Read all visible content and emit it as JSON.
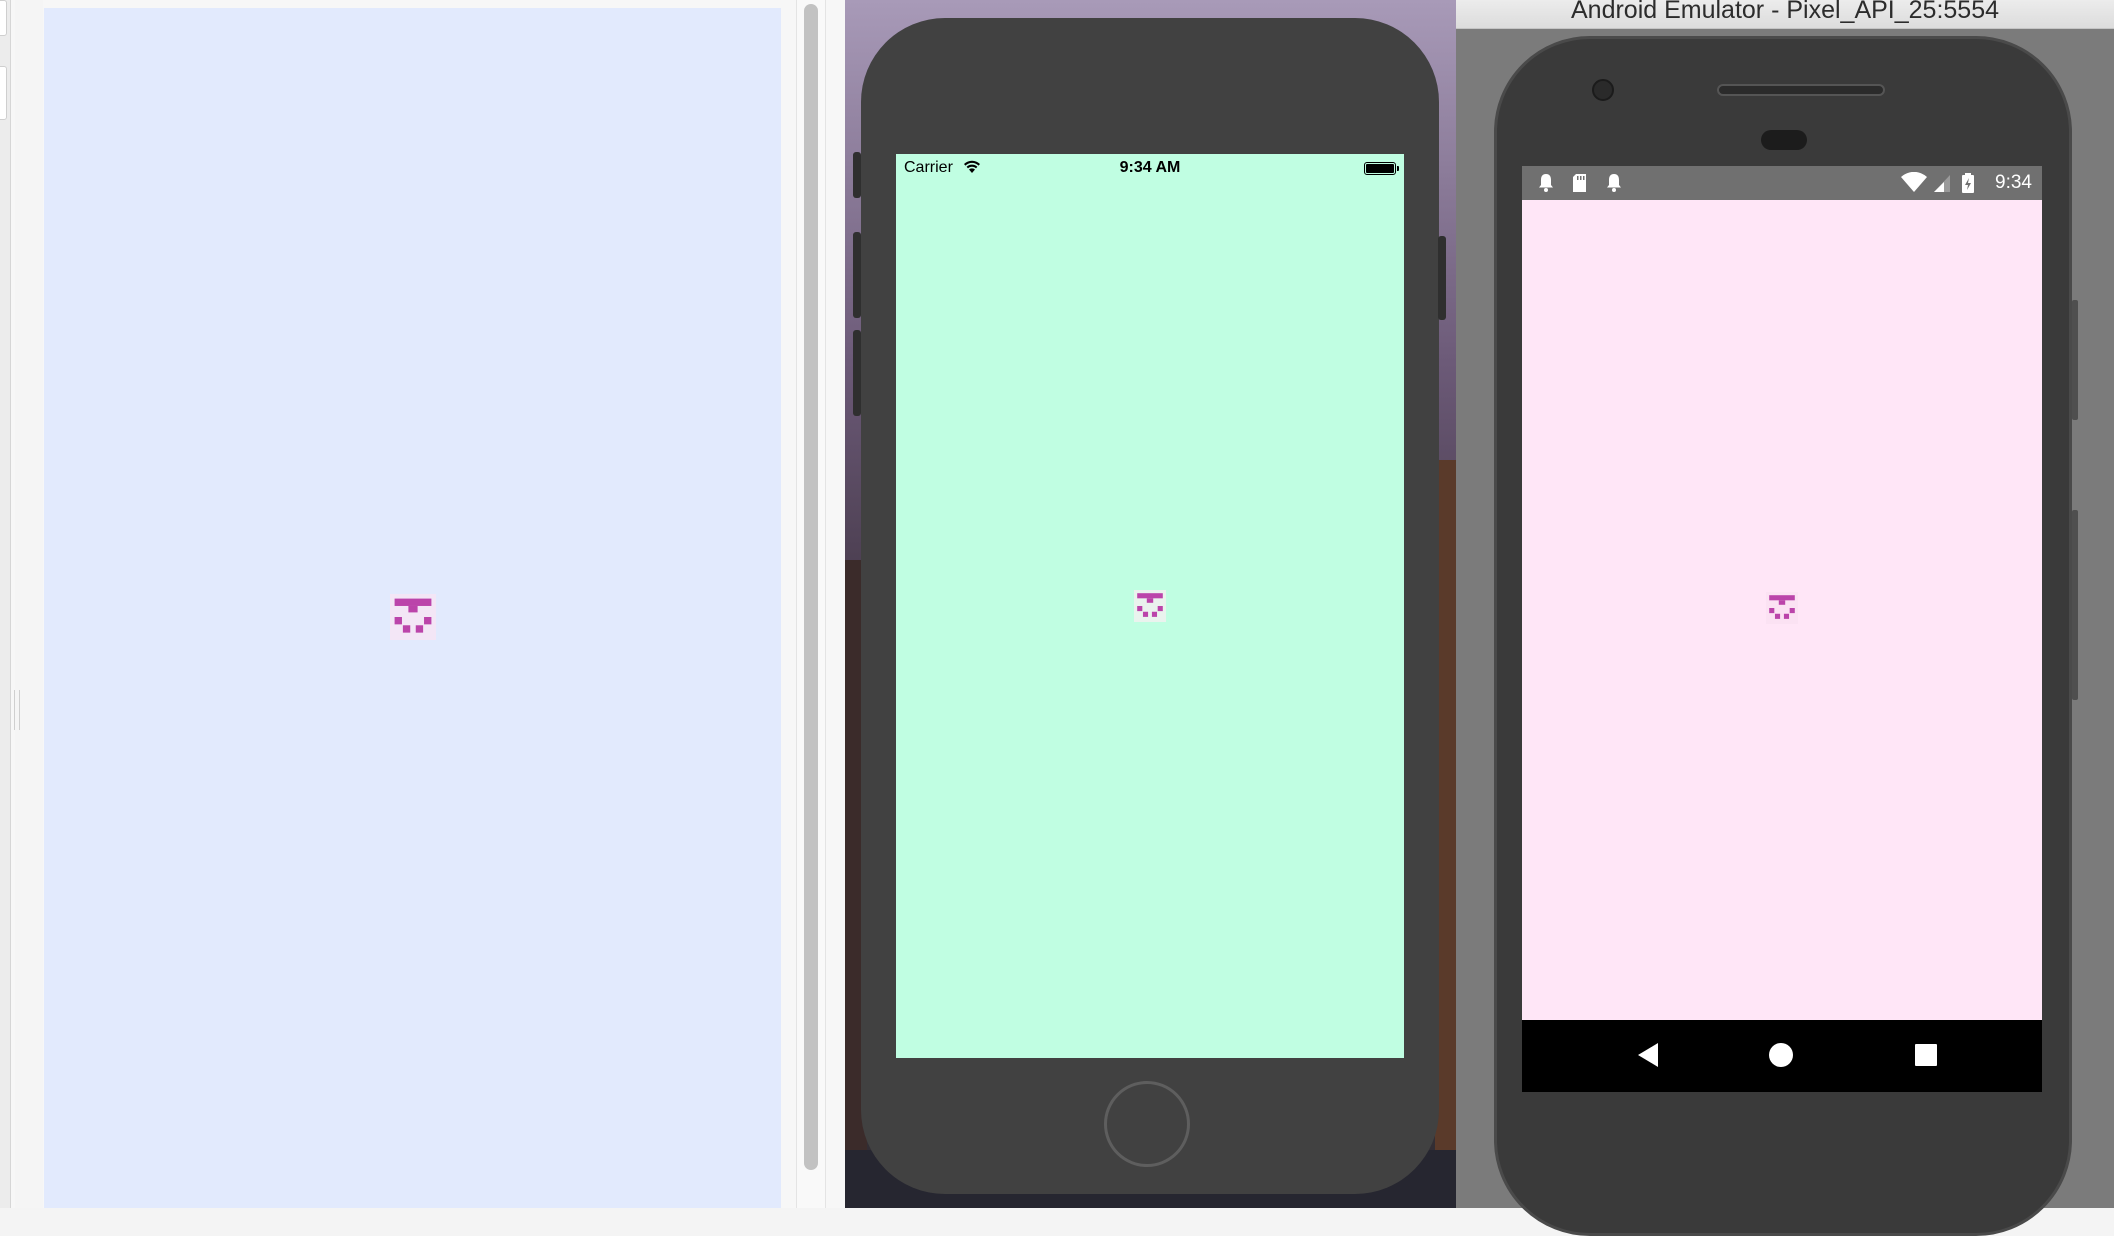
{
  "android_window": {
    "title": "Android Emulator - Pixel_API_25:5554"
  },
  "ios_simulator": {
    "status_bar": {
      "carrier": "Carrier",
      "time": "9:34 AM"
    }
  },
  "android_emulator": {
    "status_bar": {
      "time": "9:34"
    },
    "nav_bar": {
      "buttons": [
        "back",
        "home",
        "recents"
      ]
    }
  },
  "colors": {
    "web_background": "#e2eafd",
    "ios_background": "#c0fee2",
    "android_background": "#ffe6f7",
    "icon_color": "#bb44aa"
  },
  "icons": {
    "app_glyph": "pixel-face-icon",
    "ios": [
      "wifi-icon",
      "battery-icon"
    ],
    "android": [
      "notification-bell-icon",
      "sd-card-icon",
      "wifi-icon",
      "cell-signal-icon",
      "battery-charging-icon"
    ]
  }
}
